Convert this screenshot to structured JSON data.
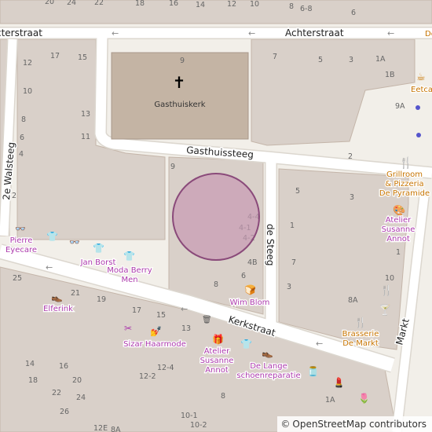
{
  "map": {
    "streets": {
      "achterstraat_left": "cterstraat",
      "achterstraat": "Achterstraat",
      "gasthuissteeg": "Gasthuissteeg",
      "de_steeg": "de Steeg",
      "kerkstraat": "Kerkstraat",
      "walsteeg": "2e Walsteeg",
      "markt": "Markt"
    },
    "landmark": {
      "name": "Gasthuiskerk",
      "icon": "church-cross-icon",
      "number": "9"
    },
    "pois": {
      "eetcafe": "Eetcafé De Kruijk",
      "grillroom_1": "Grillroom",
      "grillroom_2": "& Pizzeria",
      "grillroom_3": "De Pyramide",
      "atelier_annot_1_a": "Atelier",
      "atelier_annot_1_b": "Susanne",
      "atelier_annot_1_c": "Annot",
      "pierre_a": "Pierre",
      "pierre_b": "Eyecare",
      "jan_borst": "Jan Borst",
      "moda_a": "Moda Berry",
      "moda_b": "Men",
      "wim_blom": "Wim Blom",
      "elferink": "Elferink",
      "sizar": "Sizar Haarmode",
      "atelier_annot_2_a": "Atelier",
      "atelier_annot_2_b": "Susanne",
      "atelier_annot_2_c": "Annot",
      "delange_a": "De Lange",
      "delange_b": "schoenreparatie",
      "brasserie_a": "Brasserie",
      "brasserie_b": "De Markt"
    },
    "house_numbers": {
      "t20": "20",
      "t24": "24",
      "t22": "22",
      "t18": "18",
      "t16": "16",
      "t14": "14",
      "t12": "12",
      "t10": "10",
      "t8": "8",
      "t68": "6-8",
      "t6": "6",
      "a12": "12",
      "a17": "17",
      "a15": "15",
      "a10": "10",
      "a13": "13",
      "a8": "8",
      "a11": "11",
      "a6": "6",
      "a4": "4",
      "a2": "2",
      "b7": "7",
      "b5": "5",
      "b3": "3",
      "b1A": "1A",
      "b1B": "1B",
      "b9A": "9A",
      "b2": "2",
      "c9": "9",
      "c5": "5",
      "c3": "3",
      "c44": "4-4",
      "c41": "4-1",
      "c42": "4-2",
      "c4B": "4B",
      "c6": "6",
      "c8": "8",
      "d1": "1",
      "d7": "7",
      "d3": "3",
      "d1r": "1",
      "d10": "10",
      "d8A": "8A",
      "e25": "25",
      "e21": "21",
      "e19": "19",
      "e17": "17",
      "e15": "15",
      "e13": "13",
      "e14": "14",
      "e16": "16",
      "e18": "18",
      "e20": "20",
      "e22": "22",
      "e24": "24",
      "e26": "26",
      "e124": "12-4",
      "e122": "12-2",
      "e101": "10-1",
      "e102": "10-2",
      "e12E": "12E",
      "e8A": "8A",
      "e8": "8",
      "e1A": "1A"
    },
    "circle_highlight": {
      "fill": "#c79ab4",
      "stroke": "#8a4a7a"
    },
    "colors": {
      "building": "#d9d0c9",
      "building_outline": "#c4b5a9",
      "church": "#c4b4a4",
      "road": "#ffffff",
      "background": "#f2efe9",
      "shop_poi": "#ac39ac",
      "food_poi": "#c77400",
      "road_edge": "#dcd7cf"
    }
  },
  "attribution": {
    "symbol": "©",
    "text": "OpenStreetMap contributors"
  }
}
